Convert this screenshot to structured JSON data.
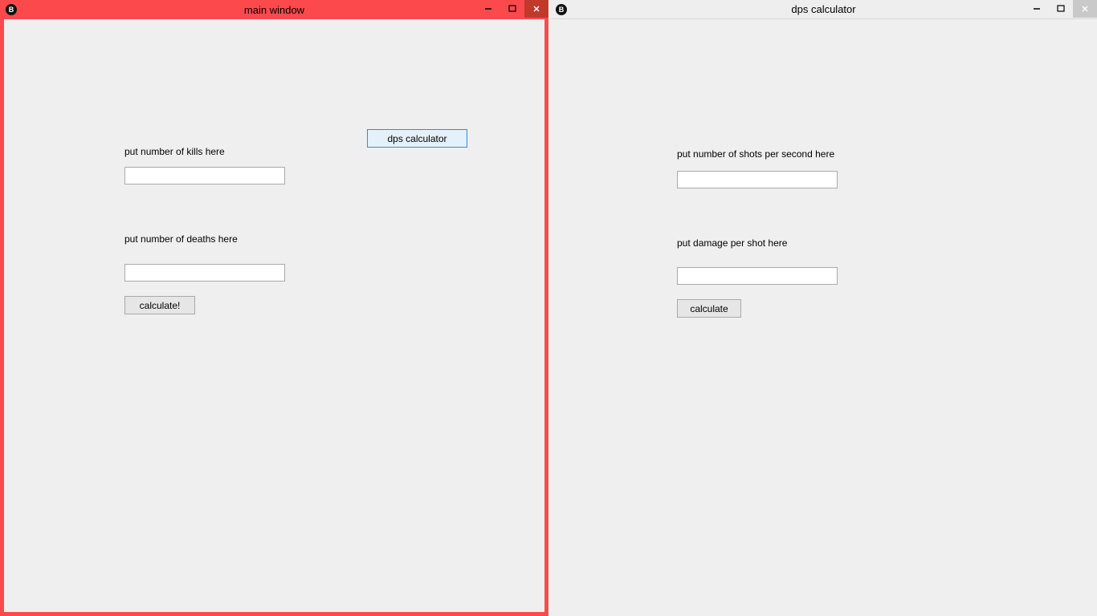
{
  "window1": {
    "title": "main window",
    "form": {
      "kills_label": "put number of kills here",
      "kills_value": "",
      "deaths_label": "put number of deaths here",
      "deaths_value": "",
      "calculate_label": "calculate!",
      "dps_button_label": "dps calculator"
    }
  },
  "window2": {
    "title": "dps calculator",
    "form": {
      "shots_label": "put number of shots per second here",
      "shots_value": "",
      "damage_label": "put damage per shot here",
      "damage_value": "",
      "calculate_label": "calculate"
    }
  }
}
